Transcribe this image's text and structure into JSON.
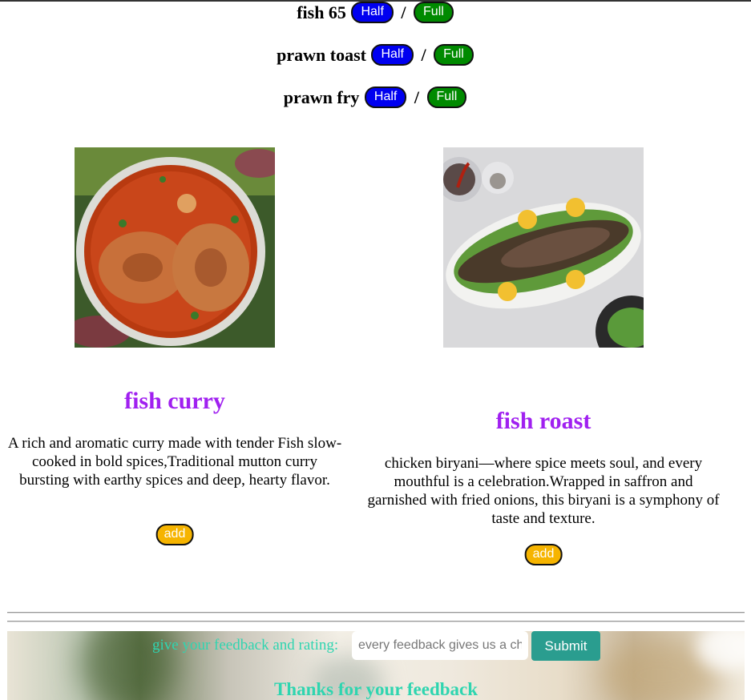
{
  "menu_items": [
    {
      "name": "fish 65",
      "half": "Half",
      "sep": "/",
      "full": "Full"
    },
    {
      "name": "prawn toast",
      "half": "Half",
      "sep": "/",
      "full": "Full"
    },
    {
      "name": "prawn fry",
      "half": "Half",
      "sep": "/",
      "full": "Full"
    }
  ],
  "cards": [
    {
      "image": "fish-curry-photo",
      "title": "fish curry",
      "description": "A rich and aromatic curry made with tender Fish slow-cooked in bold spices,Traditional mutton curry bursting with earthy spices and deep, hearty flavor.",
      "button": "add"
    },
    {
      "image": "fish-roast-photo",
      "title": "fish roast",
      "description": "chicken biryani—where spice meets soul, and every mouthful is a celebration.Wrapped in saffron and garnished with fried onions, this biryani is a symphony of taste and texture.",
      "button": "add"
    }
  ],
  "feedback": {
    "label": "give your feedback and rating:",
    "placeholder": "every feedback gives us a chance to improve",
    "submit": "Submit",
    "thanks": "Thanks for your feedback"
  },
  "colors": {
    "half": "#0000f0",
    "full": "#008a00",
    "title": "#a020f0",
    "add": "#f6b400",
    "submit": "#2a9d8f",
    "feedback_text": "#2fd5b0"
  }
}
